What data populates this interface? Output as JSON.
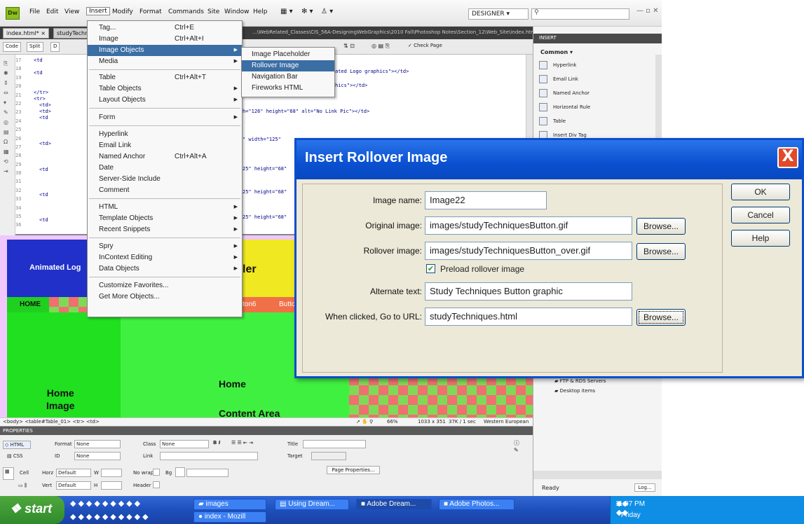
{
  "menubar": {
    "logo": "Dw",
    "items": [
      "File",
      "Edit",
      "View",
      "Insert",
      "Modify",
      "Format",
      "Commands",
      "Site",
      "Window",
      "Help"
    ],
    "workspace": "DESIGNER"
  },
  "tabs": {
    "doc1": "index.html*",
    "doc2": "studyTechni",
    "path": "...\\WebRelated_Classes\\CIS_56A-DesigningWebGraphics\\2010 Fall\\Photoshop Notes\\Section_12\\Web_Site\\index.html"
  },
  "toolbar": {
    "code": "Code",
    "split": "Split",
    "check_page": "Check Page"
  },
  "code": {
    "line_numbers": [
      "17",
      "18",
      "19",
      "20",
      "21",
      "22",
      "23",
      "24",
      "25",
      "26",
      "27",
      "28",
      "29",
      "30",
      "31",
      "32",
      "33",
      "34",
      "35",
      "36"
    ],
    "visible_lines": [
      "<td",
      "<td",
      "</tr>",
      "<tr>",
      "<td>",
      "<td>",
      "<td",
      "<td>",
      "<td",
      "<td",
      "<td"
    ],
    "frag1": "ated Logo graphics\"></td>",
    "frag2": "hics\"></td>",
    "frag3": "h=\"126\" height=\"68\" alt=\"No Link Pic\"></td>",
    "frag4": "\" width=\"125\"",
    "frag5": "25\" height=\"68\"",
    "frag6": "25\" height=\"68\"",
    "frag7": "25\" height=\"68\""
  },
  "design": {
    "animated_logo": "Animated Log",
    "header_fragment": "ler",
    "home_nav": "HOME",
    "button6": "ton6",
    "button_next": "Button",
    "home_image": "Home\nImage",
    "home_content": "Home",
    "content_area": "Content Area"
  },
  "status": {
    "tag_path": "<body> <table#Table_01> <tr> <td>",
    "zoom": "66%",
    "size": "1033 x 351",
    "download": "37K / 1 sec",
    "encoding": "Western European"
  },
  "properties": {
    "header": "PROPERTIES",
    "html_btn": "HTML",
    "css_btn": "CSS",
    "format_label": "Format",
    "format_value": "None",
    "class_label": "Class",
    "class_value": "None",
    "id_label": "ID",
    "id_value": "None",
    "link_label": "Link",
    "title_label": "Title",
    "target_label": "Target",
    "cell_label": "Cell",
    "horz_label": "Horz",
    "horz_value": "Default",
    "vert_label": "Vert",
    "vert_value": "Default",
    "w_label": "W",
    "h_label": "H",
    "nowrap_label": "No wrap",
    "header_label": "Header",
    "bg_label": "Bg",
    "page_props": "Page Properties..."
  },
  "insert_panel": {
    "header": "INSERT",
    "category": "Common",
    "items": [
      "Hyperlink",
      "Email Link",
      "Named Anchor",
      "Horizontal Rule",
      "Table",
      "Insert Div Tag"
    ],
    "files": [
      "FTP & RDS Servers",
      "Desktop items"
    ],
    "ready": "Ready",
    "log": "Log..."
  },
  "insert_menu": {
    "items": [
      {
        "label": "Tag...",
        "shortcut": "Ctrl+E"
      },
      {
        "label": "Image",
        "shortcut": "Ctrl+Alt+I"
      },
      {
        "label": "Image Objects",
        "shortcut": ""
      },
      {
        "label": "Media",
        "shortcut": ""
      },
      {
        "label": "Table",
        "shortcut": "Ctrl+Alt+T"
      },
      {
        "label": "Table Objects",
        "shortcut": ""
      },
      {
        "label": "Layout Objects",
        "shortcut": ""
      },
      {
        "label": "Form",
        "shortcut": ""
      },
      {
        "label": "Hyperlink",
        "shortcut": ""
      },
      {
        "label": "Email Link",
        "shortcut": ""
      },
      {
        "label": "Named Anchor",
        "shortcut": "Ctrl+Alt+A"
      },
      {
        "label": "Date",
        "shortcut": ""
      },
      {
        "label": "Server-Side Include",
        "shortcut": ""
      },
      {
        "label": "Comment",
        "shortcut": ""
      },
      {
        "label": "HTML",
        "shortcut": ""
      },
      {
        "label": "Template Objects",
        "shortcut": ""
      },
      {
        "label": "Recent Snippets",
        "shortcut": ""
      },
      {
        "label": "Spry",
        "shortcut": ""
      },
      {
        "label": "InContext Editing",
        "shortcut": ""
      },
      {
        "label": "Data Objects",
        "shortcut": ""
      },
      {
        "label": "Customize Favorites...",
        "shortcut": ""
      },
      {
        "label": "Get More Objects...",
        "shortcut": ""
      }
    ]
  },
  "submenu": {
    "items": [
      "Image Placeholder",
      "Rollover Image",
      "Navigation Bar",
      "Fireworks HTML"
    ]
  },
  "dialog": {
    "title": "Insert Rollover Image",
    "close": "X",
    "image_name_label": "Image name:",
    "image_name": "Image22",
    "original_label": "Original image:",
    "original": "images/studyTechniquesButton.gif",
    "rollover_label": "Rollover image:",
    "rollover": "images/studyTechniquesButton_over.gif",
    "preload_label": "Preload rollover image",
    "alt_label": "Alternate text:",
    "alt": "Study Techniques Button graphic",
    "url_label": "When clicked, Go to URL:",
    "url": "studyTechniques.html",
    "browse": "Browse...",
    "ok": "OK",
    "cancel": "Cancel",
    "help": "Help"
  },
  "taskbar": {
    "start": "start",
    "tasks": [
      "images",
      "Using Dream...",
      "Adobe Dream...",
      "Adobe Photos..."
    ],
    "task2": "index - Mozill",
    "time": "11:07 PM",
    "day": "Friday"
  }
}
